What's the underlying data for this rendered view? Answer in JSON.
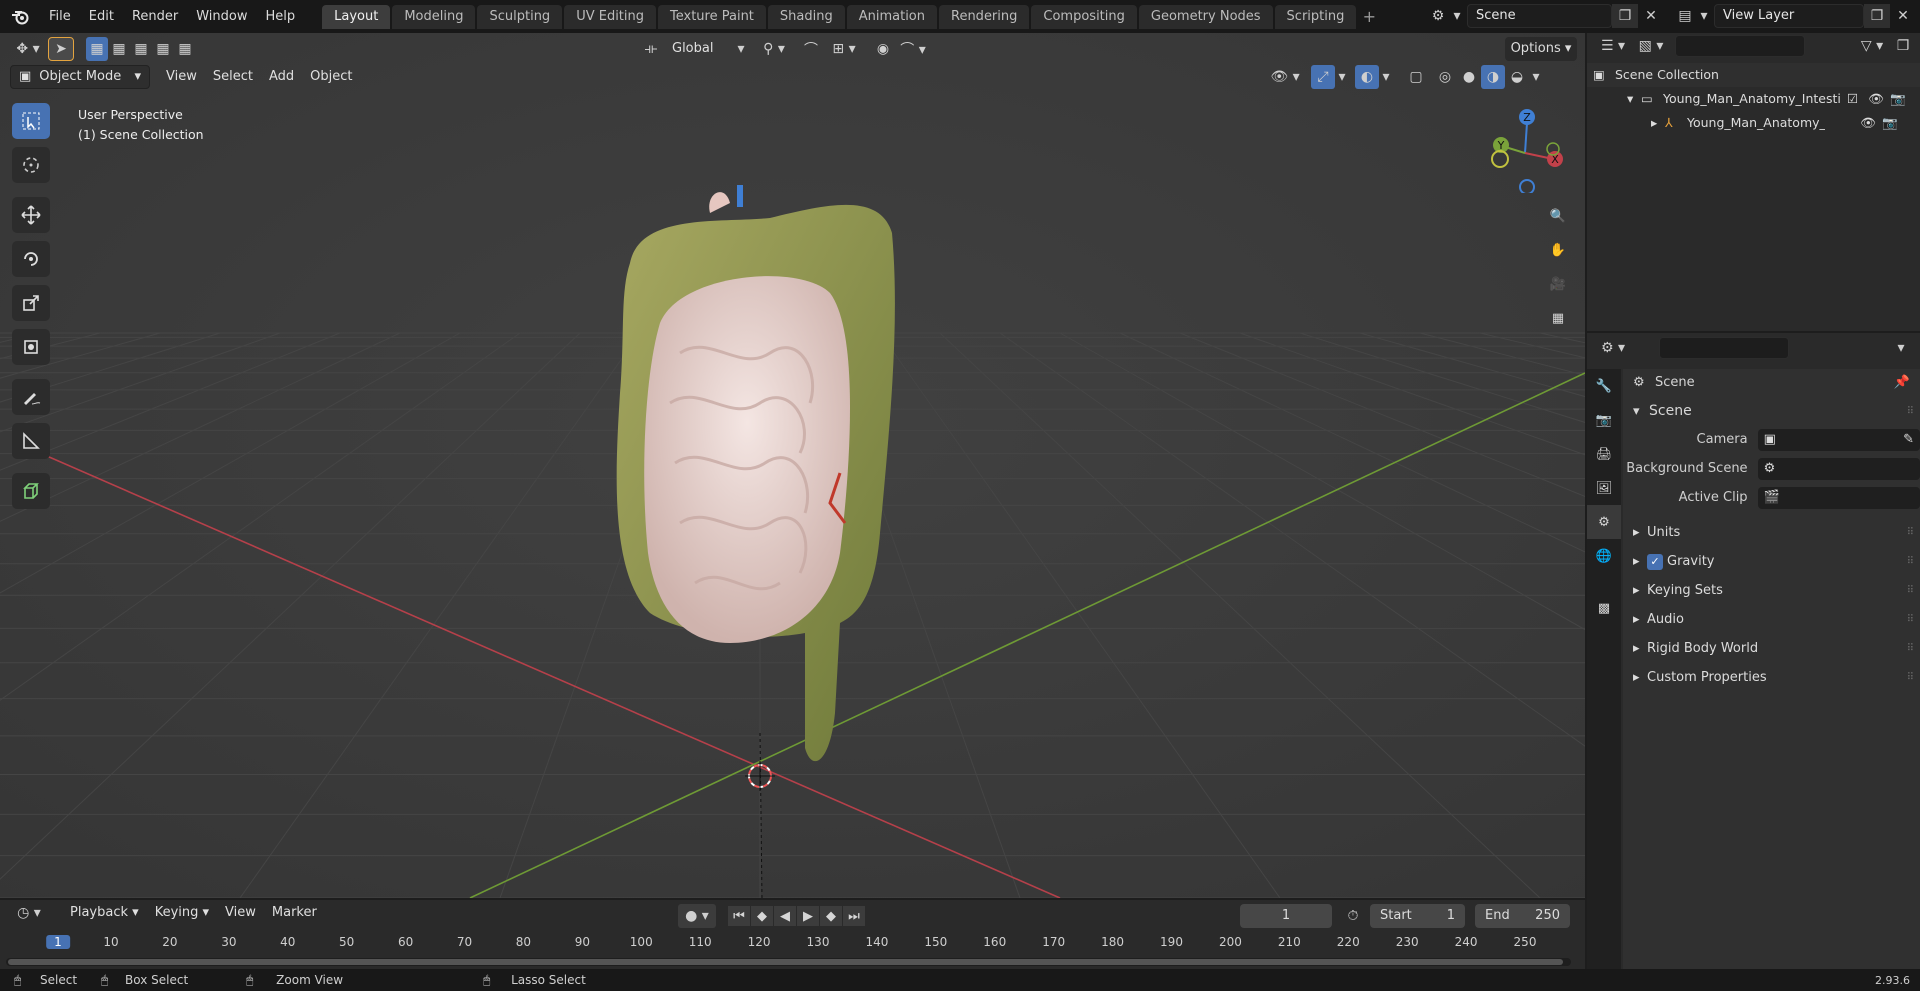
{
  "menu": [
    "File",
    "Edit",
    "Render",
    "Window",
    "Help"
  ],
  "workspaces": [
    {
      "label": "Layout",
      "active": true
    },
    {
      "label": "Modeling"
    },
    {
      "label": "Sculpting"
    },
    {
      "label": "UV Editing"
    },
    {
      "label": "Texture Paint"
    },
    {
      "label": "Shading"
    },
    {
      "label": "Animation"
    },
    {
      "label": "Rendering"
    },
    {
      "label": "Compositing"
    },
    {
      "label": "Geometry Nodes"
    },
    {
      "label": "Scripting"
    }
  ],
  "scene_field": "Scene",
  "view_layer_field": "View Layer",
  "viewport": {
    "transform_orientation": "Global",
    "options_label": "Options",
    "mode": "Object Mode",
    "header_menus": [
      "View",
      "Select",
      "Add",
      "Object"
    ],
    "overlay_text_1": "User Perspective",
    "overlay_text_2": "(1) Scene Collection",
    "gizmo_axes": {
      "z": "Z",
      "y": "Y",
      "x": "X"
    }
  },
  "outliner": {
    "search_placeholder": "",
    "root": "Scene Collection",
    "items": [
      {
        "label": "Young_Man_Anatomy_Intestine"
      },
      {
        "label": "Young_Man_Anatomy_Intestine"
      }
    ]
  },
  "properties": {
    "search_placeholder": "",
    "context": "Scene",
    "section": "Scene",
    "fields": [
      {
        "label": "Camera"
      },
      {
        "label": "Background Scene"
      },
      {
        "label": "Active Clip"
      }
    ],
    "subsections": [
      "Units",
      "Gravity",
      "Keying Sets",
      "Audio",
      "Rigid Body World",
      "Custom Properties"
    ],
    "gravity_checked": true
  },
  "timeline": {
    "menus": [
      "Playback",
      "Keying",
      "View",
      "Marker"
    ],
    "current_frame": "1",
    "start_label": "Start",
    "start_value": "1",
    "end_label": "End",
    "end_value": "250",
    "ticks": [
      "1",
      "10",
      "20",
      "30",
      "40",
      "50",
      "60",
      "70",
      "80",
      "90",
      "100",
      "110",
      "120",
      "130",
      "140",
      "150",
      "160",
      "170",
      "180",
      "190",
      "200",
      "210",
      "220",
      "230",
      "240",
      "250"
    ]
  },
  "statusbar": {
    "select": "Select",
    "box_select": "Box Select",
    "zoom_view": "Zoom View",
    "lasso_select": "Lasso Select",
    "version": "2.93.6"
  },
  "colors": {
    "accent": "#4772b3",
    "x_axis": "#c2414a",
    "y_axis": "#7aa33a",
    "z_axis": "#3f7fd4"
  }
}
